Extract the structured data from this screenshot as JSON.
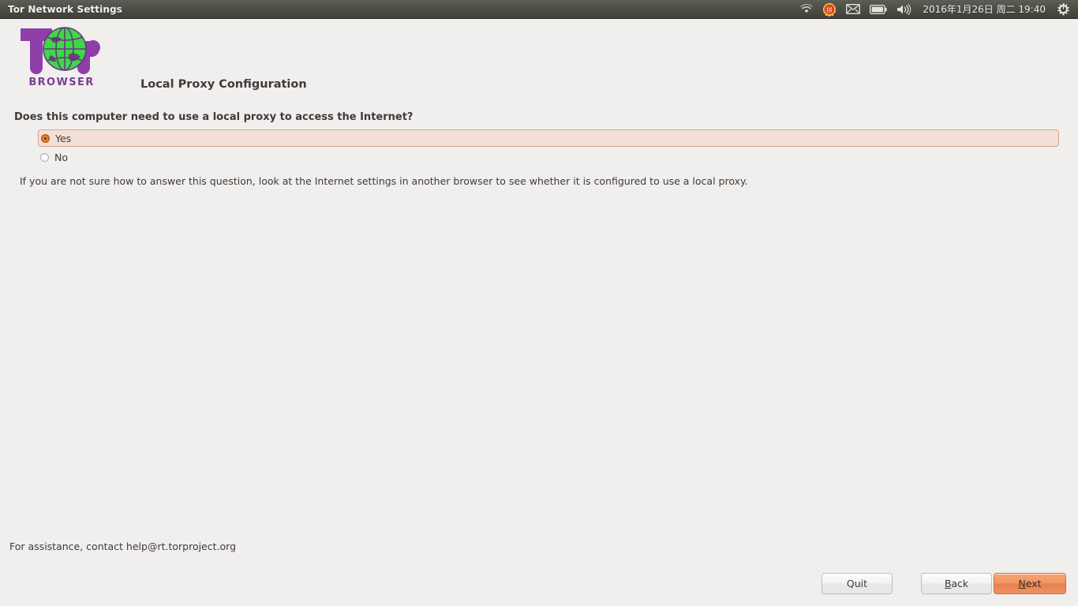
{
  "window": {
    "title": "Tor Network Settings"
  },
  "tray": {
    "icons": [
      {
        "name": "wifi-icon",
        "glyph": "wifi"
      },
      {
        "name": "input-method-icon",
        "glyph": "拼"
      },
      {
        "name": "mail-icon",
        "glyph": "envelope"
      },
      {
        "name": "battery-icon",
        "glyph": "battery"
      },
      {
        "name": "volume-icon",
        "glyph": "speaker"
      }
    ],
    "clock": "2016年1月26日 周二 19:40",
    "session_icon": "power-gear-icon"
  },
  "logo": {
    "wordmark": "BROWSER",
    "alt": "Tor Browser logo",
    "purple": "#7b3d94",
    "green": "#3fd74a"
  },
  "main": {
    "page_title": "Local Proxy Configuration",
    "question": "Does this computer need to use a local proxy to access the Internet?",
    "options": [
      {
        "label": "Yes",
        "selected": true
      },
      {
        "label": "No",
        "selected": false
      }
    ],
    "hint": "If you are not sure how to answer this question, look at the Internet settings in another browser to see whether it is configured to use a local proxy."
  },
  "footer": {
    "assistance": "For assistance, contact help@rt.torproject.org",
    "buttons": {
      "quit": {
        "label": "Quit",
        "mnemonic": ""
      },
      "back": {
        "label": "Back",
        "mnemonic": "B"
      },
      "next": {
        "label": "Next",
        "mnemonic": "N"
      }
    }
  },
  "colors": {
    "titlebar_top": "#5d5d53",
    "titlebar_bottom": "#413f3a",
    "background": "#f0efee",
    "selection_fill": "#f3dfd6",
    "selection_border": "#d8a58d",
    "accent_orange": "#e8804a"
  }
}
